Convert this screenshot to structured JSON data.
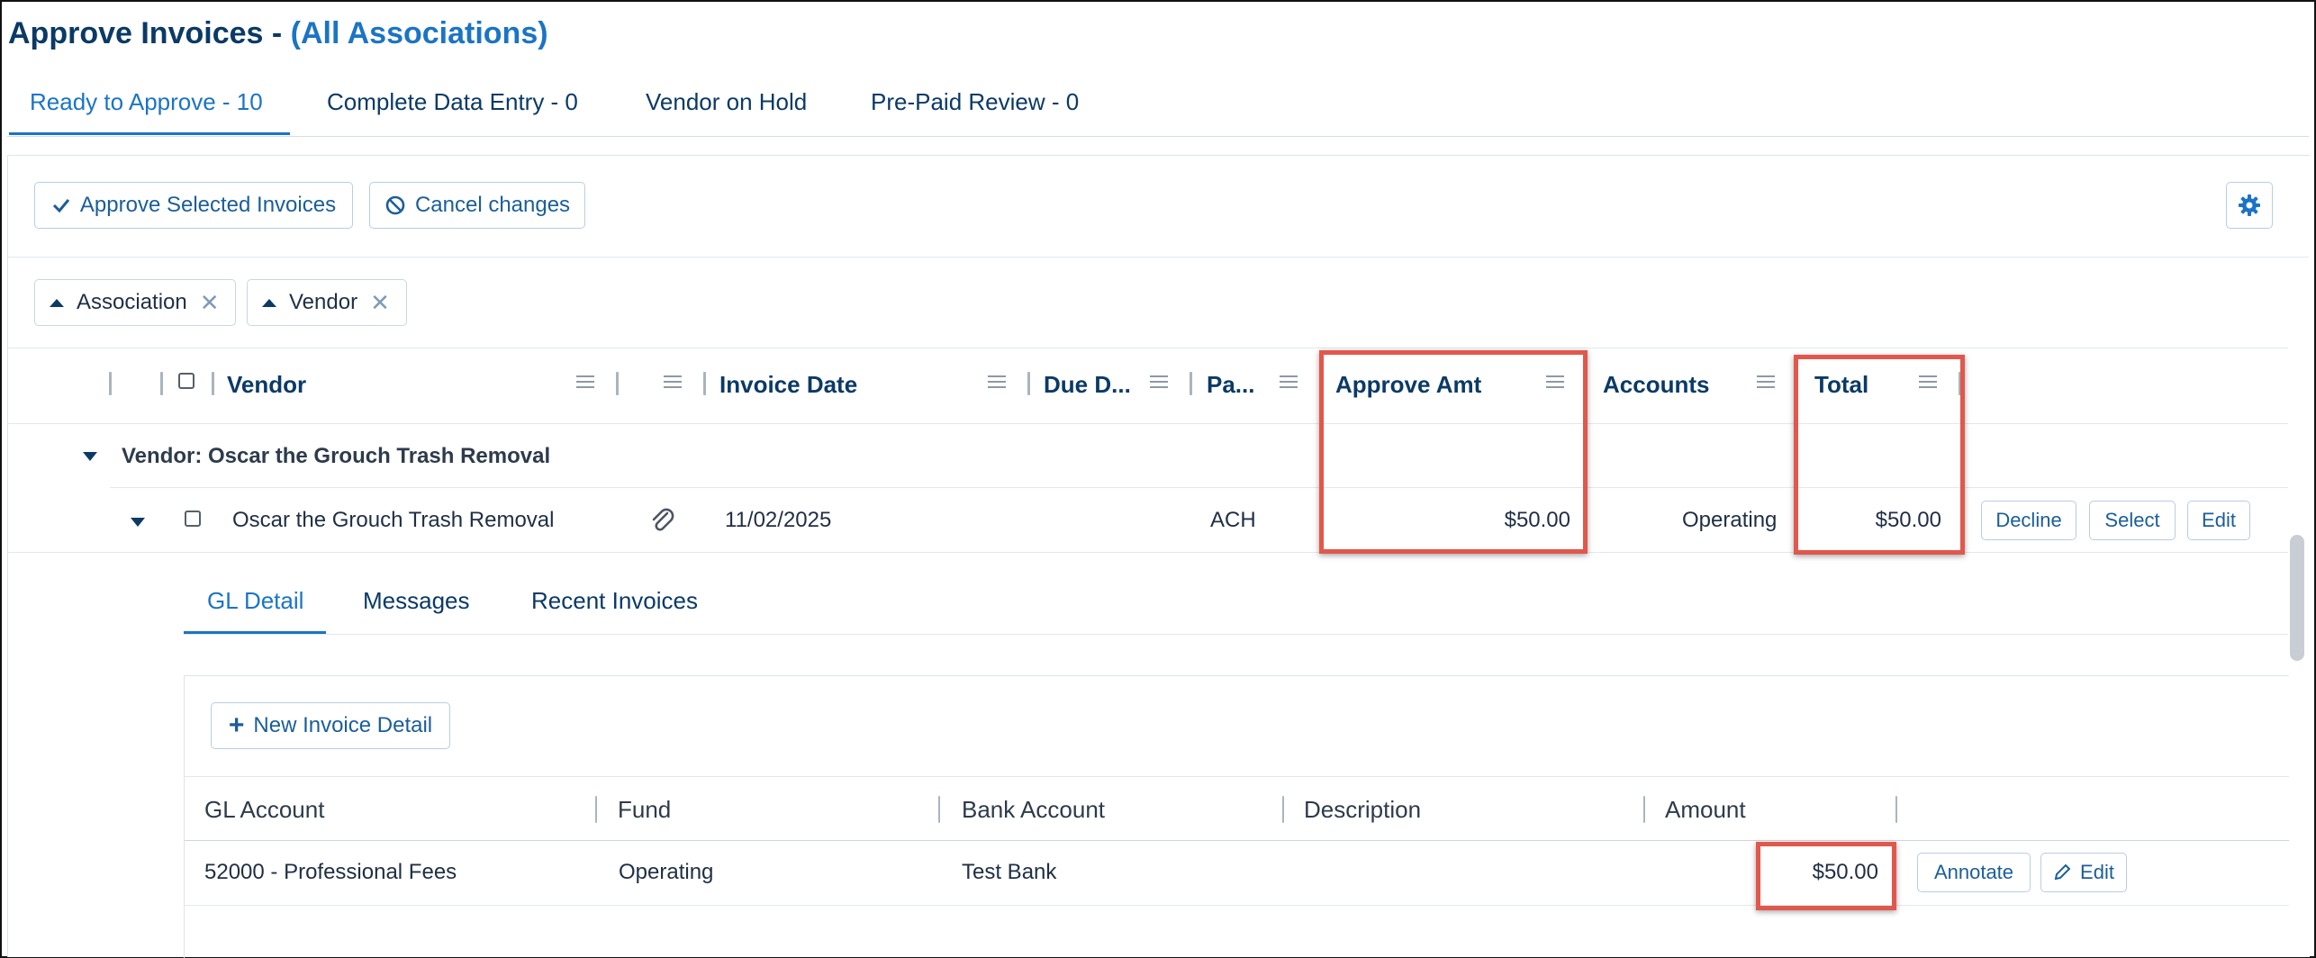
{
  "page": {
    "title": "Approve Invoices -",
    "title_sub": "(All Associations)"
  },
  "tabs": [
    {
      "label": "Ready to Approve - 10",
      "active": true
    },
    {
      "label": "Complete Data Entry - 0"
    },
    {
      "label": "Vendor on Hold"
    },
    {
      "label": "Pre-Paid Review - 0"
    }
  ],
  "toolbar": {
    "approve_label": "Approve Selected Invoices",
    "cancel_label": "Cancel changes"
  },
  "groups": {
    "chips": [
      {
        "label": "Association"
      },
      {
        "label": "Vendor"
      }
    ]
  },
  "table": {
    "columns": {
      "vendor": "Vendor",
      "invoice_date": "Invoice Date",
      "due_date": "Due D...",
      "pay": "Pa...",
      "approve_amt": "Approve Amt",
      "accounts": "Accounts",
      "total": "Total"
    },
    "group_header": "Vendor: Oscar the Grouch Trash Removal",
    "row": {
      "vendor": "Oscar the Grouch Trash Removal",
      "invoice_date": "11/02/2025",
      "pay_type": "ACH",
      "approve_amt": "$50.00",
      "accounts": "Operating",
      "total": "$50.00",
      "decline_label": "Decline",
      "select_label": "Select",
      "edit_label": "Edit"
    }
  },
  "detail": {
    "tabs": [
      {
        "label": "GL Detail",
        "active": true
      },
      {
        "label": "Messages"
      },
      {
        "label": "Recent Invoices"
      }
    ],
    "new_detail_label": "New Invoice Detail",
    "columns": {
      "gl_account": "GL Account",
      "fund": "Fund",
      "bank_account": "Bank Account",
      "description": "Description",
      "amount": "Amount"
    },
    "rows": [
      {
        "gl_account": "52000 - Professional Fees",
        "fund": "Operating",
        "bank_account": "Test Bank",
        "description": "",
        "amount": "$50.00",
        "annotate_label": "Annotate",
        "edit_label": "Edit"
      }
    ]
  },
  "colors": {
    "accent": "#1b74c5",
    "heading": "#0b3a66",
    "highlight": "#e2574c"
  }
}
